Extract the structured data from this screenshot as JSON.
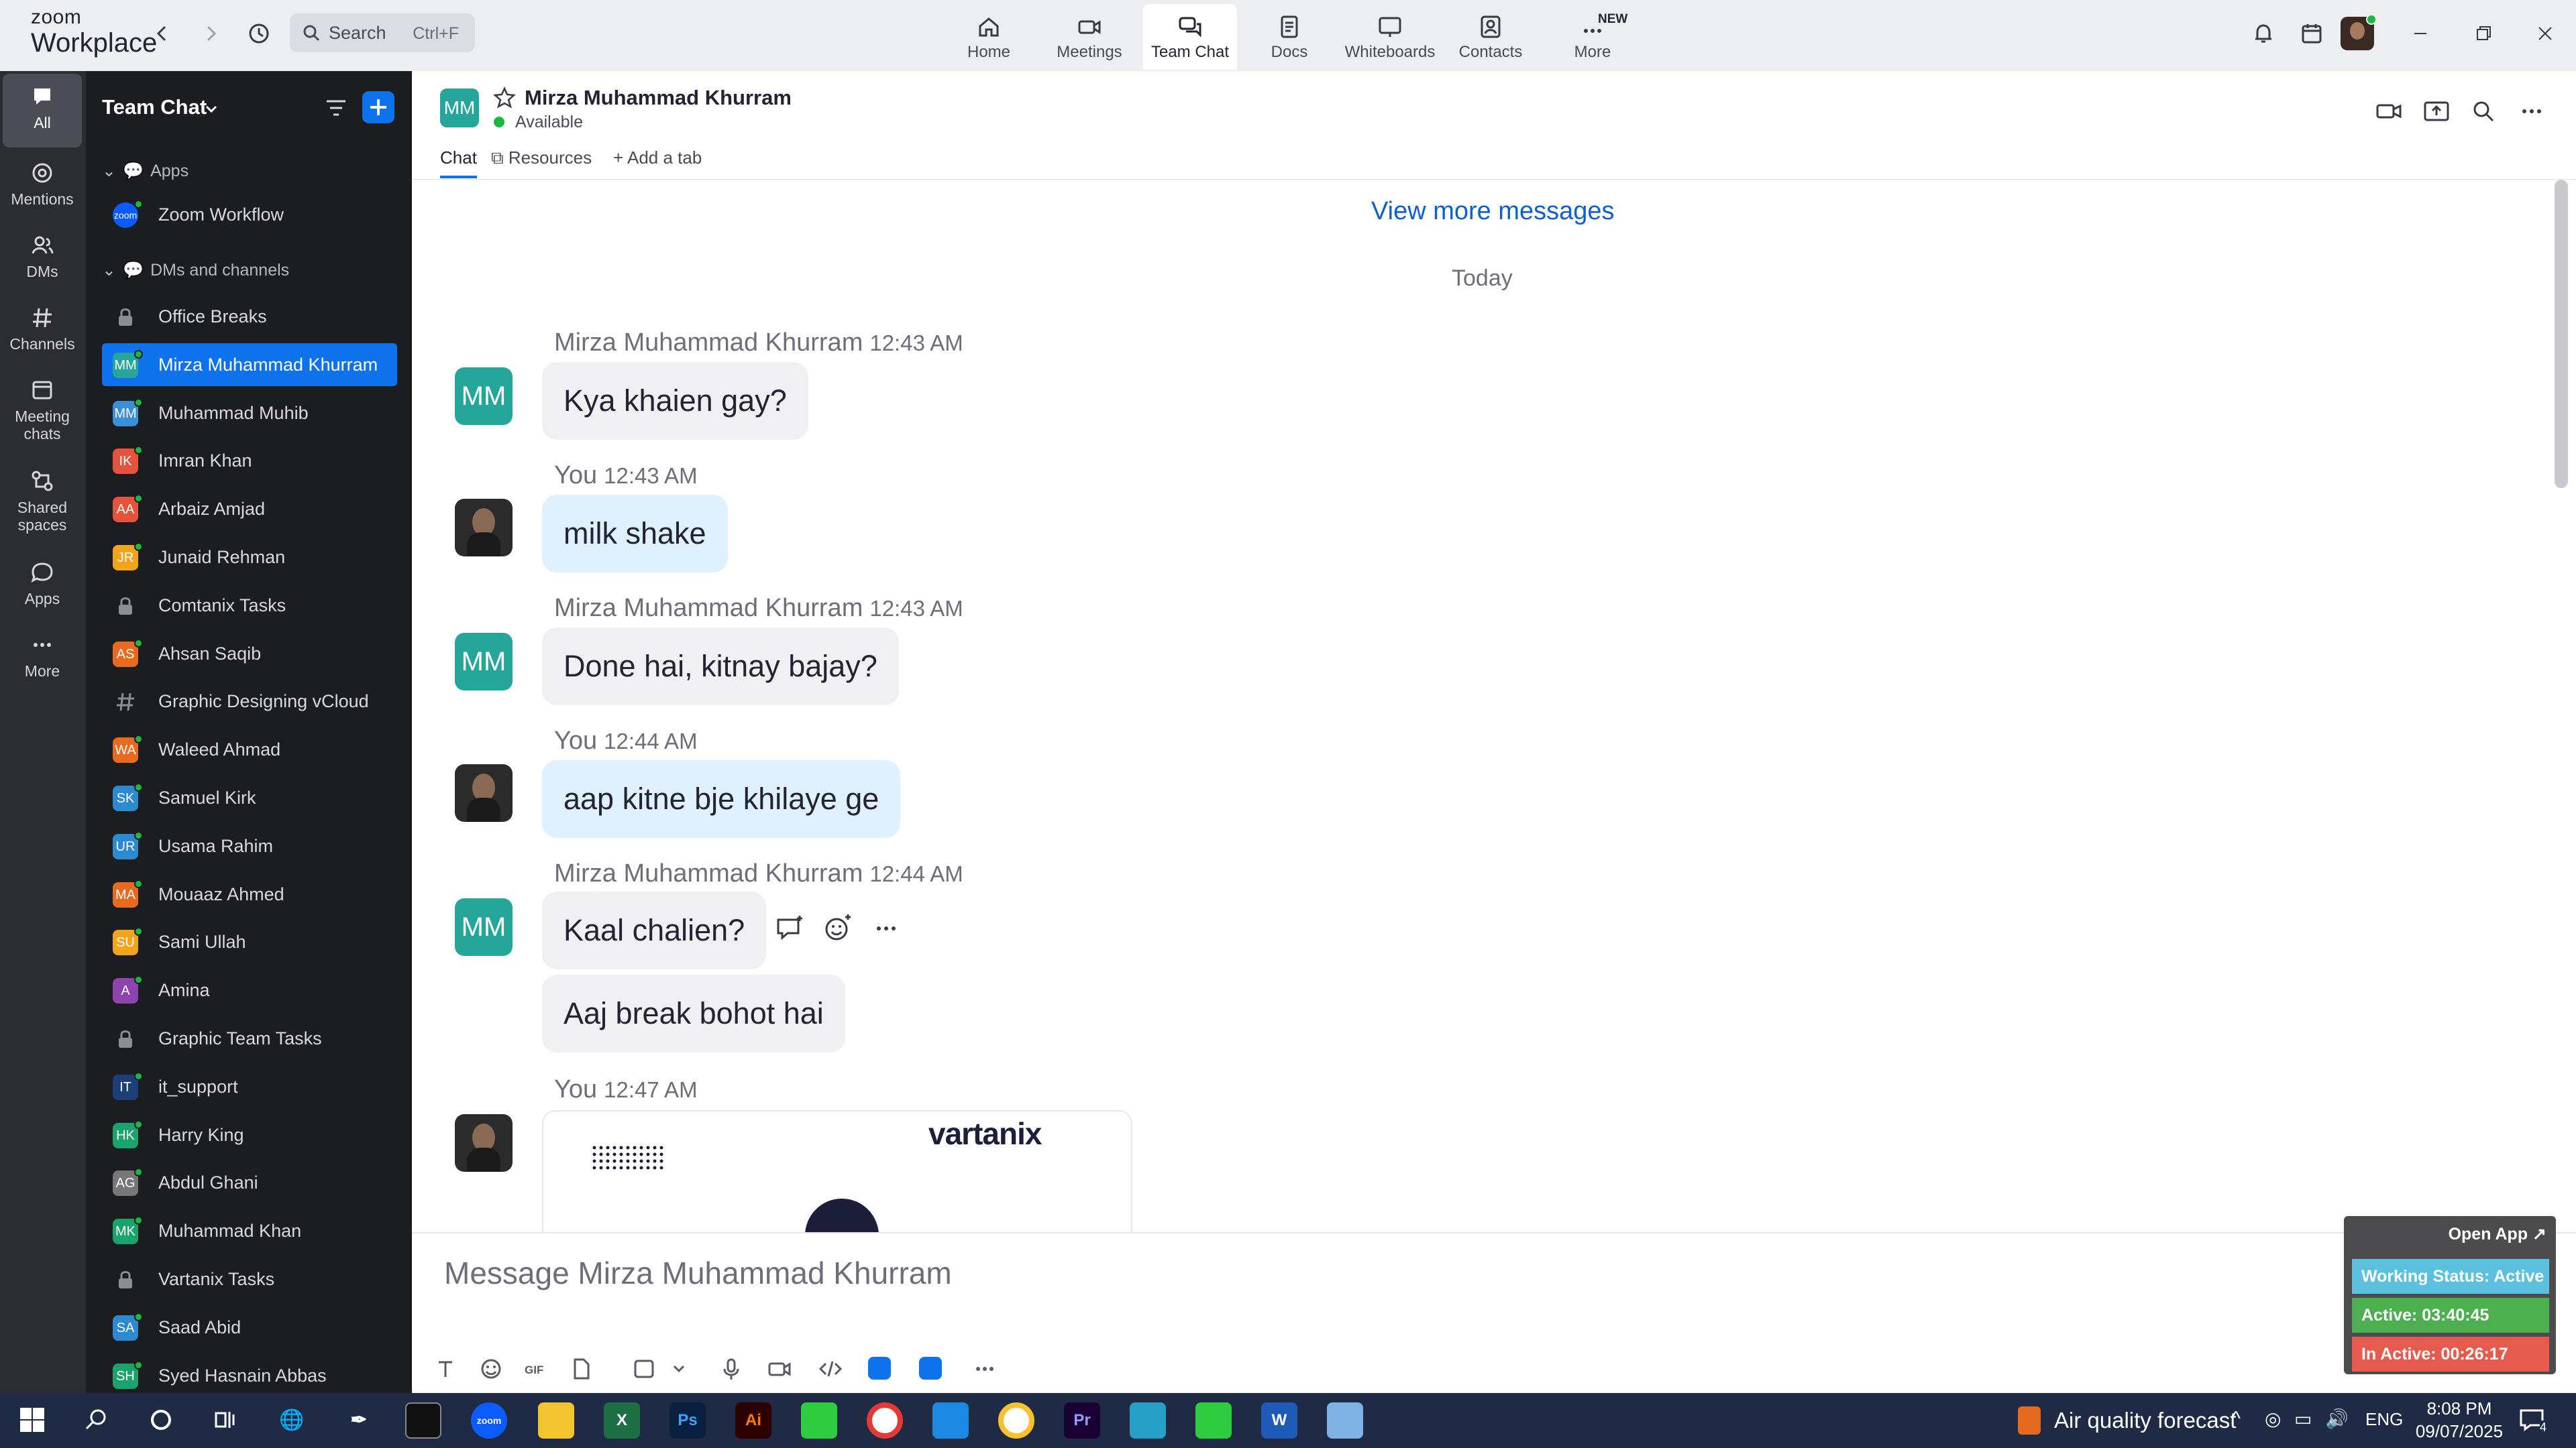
{
  "app": {
    "brand_line1": "zoom",
    "brand_line2": "Workplace"
  },
  "search": {
    "placeholder": "Search",
    "shortcut": "Ctrl+F"
  },
  "nav_tabs": [
    {
      "label": "Home",
      "icon": "home-icon"
    },
    {
      "label": "Meetings",
      "icon": "video-camera-icon"
    },
    {
      "label": "Team Chat",
      "icon": "chat-bubbles-icon",
      "active": true
    },
    {
      "label": "Docs",
      "icon": "document-icon"
    },
    {
      "label": "Whiteboards",
      "icon": "whiteboard-icon"
    },
    {
      "label": "Contacts",
      "icon": "contact-card-icon"
    },
    {
      "label": "More",
      "icon": "more-dots-icon",
      "badge": "NEW"
    }
  ],
  "rail": [
    {
      "label": "All",
      "active": true
    },
    {
      "label": "Mentions"
    },
    {
      "label": "DMs"
    },
    {
      "label": "Channels"
    },
    {
      "label": "Meeting chats"
    },
    {
      "label": "Shared spaces"
    },
    {
      "label": "Apps"
    },
    {
      "label": "More"
    }
  ],
  "sidebar": {
    "title": "Team Chat",
    "section_apps": "Apps",
    "section_dms": "DMs and channels",
    "apps": [
      {
        "name": "Zoom Workflow",
        "initials": "zoom",
        "color": "#0b5cff"
      }
    ],
    "items": [
      {
        "name": "Office Breaks",
        "type": "lock"
      },
      {
        "name": "Mirza Muhammad Khurram",
        "initials": "MM",
        "color": "#26a69a",
        "active": true
      },
      {
        "name": "Muhammad Muhib",
        "initials": "MM",
        "color": "#3a8fd6"
      },
      {
        "name": "Imran Khan",
        "initials": "IK",
        "color": "#e5533d"
      },
      {
        "name": "Arbaiz Amjad",
        "initials": "AA",
        "color": "#e5533d"
      },
      {
        "name": "Junaid Rehman",
        "initials": "JR",
        "color": "#f2a51a"
      },
      {
        "name": "Comtanix Tasks",
        "type": "lock"
      },
      {
        "name": "Ahsan Saqib",
        "initials": "AS",
        "color": "#e86a1e"
      },
      {
        "name": "Graphic Designing vCloud",
        "type": "hash"
      },
      {
        "name": "Waleed Ahmad",
        "initials": "WA",
        "color": "#e86a1e"
      },
      {
        "name": "Samuel Kirk",
        "initials": "SK",
        "color": "#2b8ad0"
      },
      {
        "name": "Usama Rahim",
        "initials": "UR",
        "color": "#2b8ad0"
      },
      {
        "name": "Mouaaz Ahmed",
        "initials": "MA",
        "color": "#e86a1e"
      },
      {
        "name": "Sami Ullah",
        "initials": "SU",
        "color": "#f2a51a"
      },
      {
        "name": "Amina",
        "initials": "A",
        "color": "#8e44ad"
      },
      {
        "name": "Graphic Team Tasks",
        "type": "lock"
      },
      {
        "name": "it_support",
        "initials": "IT",
        "color": "#1c3f7a"
      },
      {
        "name": "Harry King",
        "initials": "HK",
        "color": "#1aa36b"
      },
      {
        "name": "Abdul Ghani",
        "initials": "AG",
        "color": "#777777"
      },
      {
        "name": "Muhammad Khan",
        "initials": "MK",
        "color": "#1aa36b"
      },
      {
        "name": "Vartanix Tasks",
        "type": "lock"
      },
      {
        "name": "Saad Abid",
        "initials": "SA",
        "color": "#2b8ad0"
      },
      {
        "name": "Syed Hasnain Abbas",
        "initials": "SH",
        "color": "#1aa36b"
      }
    ]
  },
  "chat": {
    "name": "Mirza Muhammad Khurram",
    "initials": "MM",
    "status": "Available",
    "tabs": [
      "Chat",
      "Resources",
      "Add a tab"
    ],
    "view_more": "View more messages",
    "day_divider": "Today",
    "messages": [
      {
        "sender": "Mirza Muhammad Khurram",
        "time": "12:43 AM",
        "text": "Kya khaien gay?",
        "me": false
      },
      {
        "sender": "You",
        "time": "12:43 AM",
        "text": "milk shake",
        "me": true
      },
      {
        "sender": "Mirza Muhammad Khurram",
        "time": "12:43 AM",
        "text": "Done hai, kitnay bajay?",
        "me": false
      },
      {
        "sender": "You",
        "time": "12:44 AM",
        "text": "aap kitne bje khilaye ge",
        "me": true
      },
      {
        "sender": "Mirza Muhammad Khurram",
        "time": "12:44 AM",
        "text": "Kaal chalien?",
        "text2": "Aaj break bohot hai",
        "me": false
      },
      {
        "sender": "You",
        "time": "12:47 AM",
        "image_logo": "vartanix",
        "me": true
      }
    ],
    "composer_placeholder": "Message Mirza Muhammad Khurram"
  },
  "widget": {
    "open_app": "Open App ↗",
    "working_status": "Working Status: Active",
    "active": "Active: 03:40:45",
    "inactive": "In Active: 00:26:17",
    "colors": {
      "working": "#5bc0de",
      "active": "#4caf50",
      "inactive": "#e55b4d"
    }
  },
  "taskbar": {
    "weather": "Air quality forecast",
    "language": "ENG",
    "time": "8:08 PM",
    "date": "09/07/2025",
    "notification_count": "4"
  },
  "colors": {
    "accent": "#0e72ed",
    "online": "#1bb83f"
  }
}
